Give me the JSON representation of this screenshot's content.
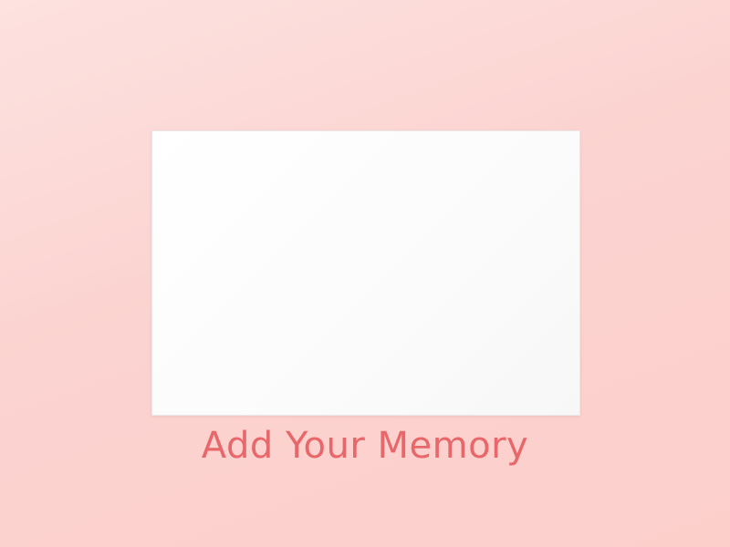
{
  "memory_card": {
    "prompt_label": "Add Your Memory"
  },
  "colors": {
    "background": "#fbd3d0",
    "card": "#ffffff",
    "accent": "#e8676a"
  }
}
